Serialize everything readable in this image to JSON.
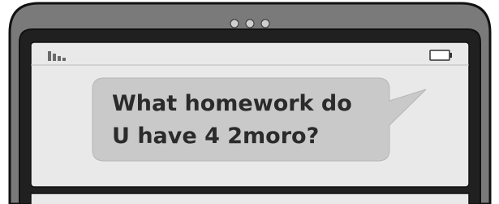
{
  "message": {
    "lines": [
      "What homework do",
      "U have 4 2moro?"
    ]
  },
  "icons": {
    "camera": "dots-icon",
    "signal": "signal-bars-icon",
    "battery": "battery-icon"
  },
  "colors": {
    "phone_body": "#7a7a7a",
    "screen_bezel": "#202020",
    "screen": "#e9e9e9",
    "bubble": "#c9c9c9",
    "text": "#2b2b2b",
    "outline": "#111111"
  }
}
